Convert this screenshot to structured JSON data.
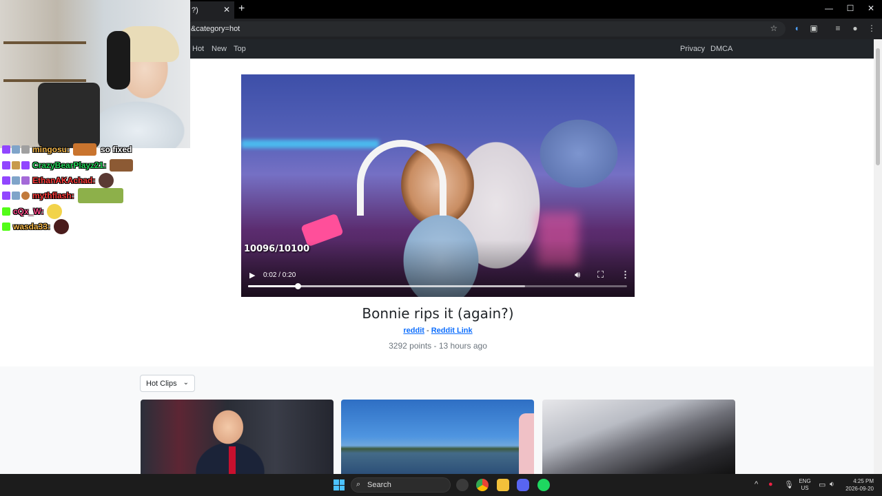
{
  "browser": {
    "tab_title": "?)",
    "tab_close": "✕",
    "new_tab": "+",
    "url": "&category=hot",
    "window_controls": [
      "—",
      "☐",
      "✕"
    ]
  },
  "site_nav": {
    "left": [
      "Hot",
      "New",
      "Top"
    ],
    "right": [
      "Privacy",
      "DMCA"
    ]
  },
  "video": {
    "counter": "10096/10100",
    "time": "0:02 / 0:20",
    "played_fraction": 0.13,
    "buffered_fraction": 0.73
  },
  "clip": {
    "title": "Bonnie rips it (again?)",
    "link1": "reddit",
    "separator": "-",
    "link2": "Reddit Link",
    "meta": "3292 points - 13 hours ago"
  },
  "clips_section": {
    "dropdown_label": "Hot Clips",
    "dropdown_chevron": "⌄"
  },
  "chat": [
    {
      "name": "mingosu:",
      "color": "#f5b84a",
      "text": "so fixed"
    },
    {
      "name": "CrazyBearPlayz21:",
      "color": "#22d55a",
      "text": ""
    },
    {
      "name": "EthanAKAchad:",
      "color": "#ff3b3b",
      "text": ""
    },
    {
      "name": "mythflash:",
      "color": "#ff3b3b",
      "text": ""
    },
    {
      "name": "cQx_W:",
      "color": "#ff4a8a",
      "text": ""
    },
    {
      "name": "wasda33:",
      "color": "#f5b84a",
      "text": ""
    }
  ],
  "taskbar": {
    "search_label": "Search",
    "lang": [
      "ENG",
      "US"
    ],
    "time": "4:25 PM",
    "date": "2026-09-20"
  },
  "colors": {
    "link": "#0d6efd",
    "navbar": "#212529",
    "accent_windows": "#4cc2ff"
  }
}
